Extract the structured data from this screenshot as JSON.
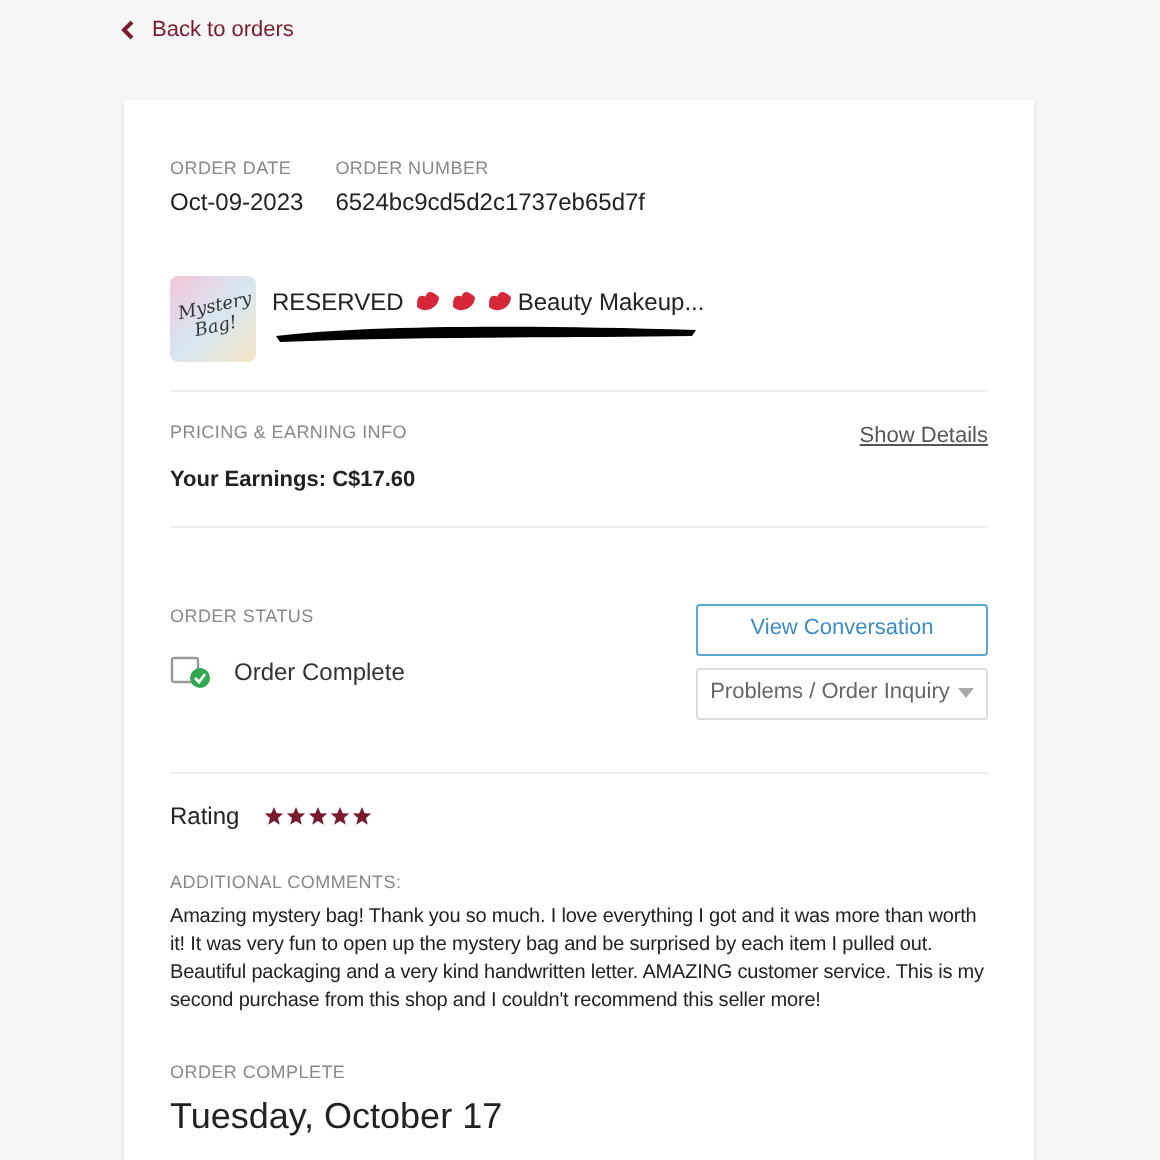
{
  "back_link": {
    "label": "Back to orders"
  },
  "order": {
    "date_label": "ORDER DATE",
    "date": "Oct-09-2023",
    "number_label": "ORDER NUMBER",
    "number": "6524bc9cd5d2c1737eb65d7f"
  },
  "item": {
    "title_parts": [
      {
        "kind": "text",
        "text": "RESERVED"
      },
      {
        "kind": "lips"
      },
      {
        "kind": "lips"
      },
      {
        "kind": "lips"
      },
      {
        "kind": "text",
        "text": "Beauty Makeup..."
      }
    ],
    "thumbnail_text": "Mystery Bag!"
  },
  "pricing": {
    "label": "PRICING & EARNING INFO",
    "details_link": "Show Details",
    "earnings": "Your Earnings: C$17.60"
  },
  "status": {
    "label": "ORDER STATUS",
    "value": "Order Complete",
    "complete": true,
    "buttons": [
      {
        "kind": "outline",
        "label": "View Conversation"
      },
      {
        "kind": "dropdown",
        "label": "Problems / Order Inquiry"
      }
    ]
  },
  "rating": {
    "label": "Rating",
    "stars": 5
  },
  "comments": {
    "label": "ADDITIONAL COMMENTS:",
    "text": "Amazing mystery bag! Thank you so much. I love everything I got and it was more than worth it! It was very fun to open up the mystery bag and be surprised by each item I pulled out. Beautiful packaging and a very kind handwritten letter. AMAZING customer service. This is my second purchase from this shop and I couldn't recommend this seller more!"
  },
  "completed": {
    "label": "ORDER COMPLETE",
    "date": "Tuesday, October 17"
  }
}
